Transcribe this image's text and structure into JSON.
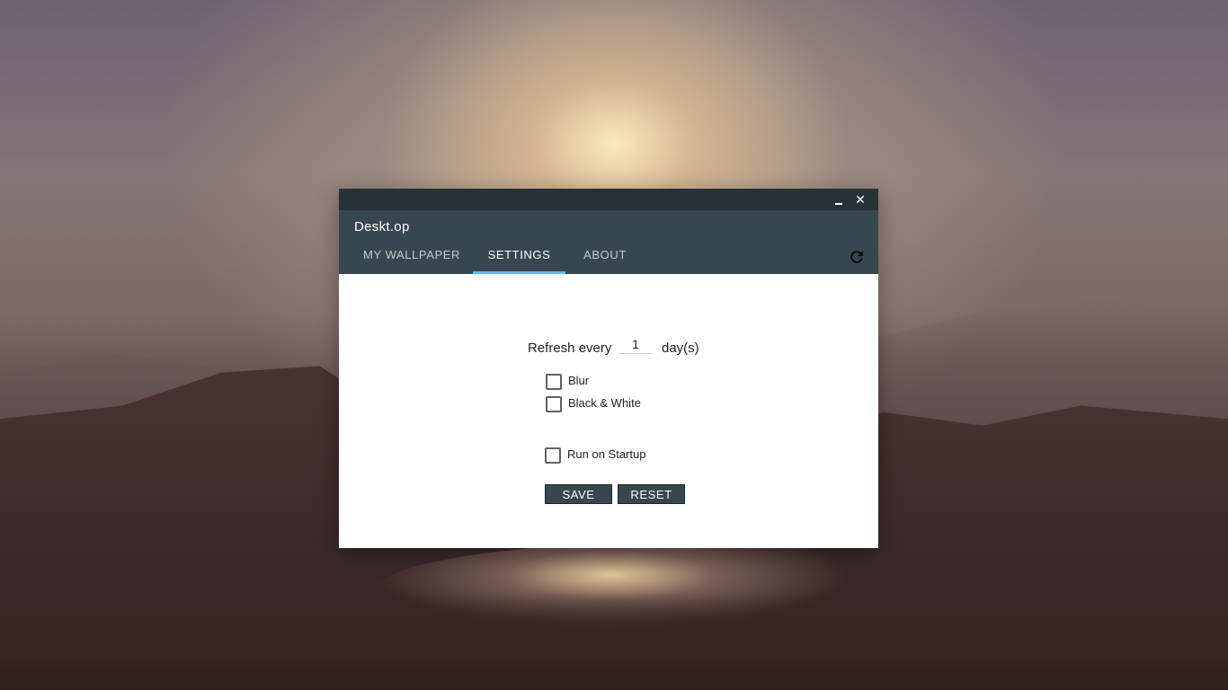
{
  "window": {
    "title": "Deskt.op",
    "close_glyph": "✕"
  },
  "tabs": [
    {
      "label": "MY WALLPAPER",
      "active": false
    },
    {
      "label": "SETTINGS",
      "active": true
    },
    {
      "label": "ABOUT",
      "active": false
    }
  ],
  "settings": {
    "refresh_label": "Refresh every",
    "refresh_value": "1",
    "refresh_unit": "day(s)",
    "options": [
      {
        "label": "Blur",
        "checked": false
      },
      {
        "label": "Black & White",
        "checked": false
      },
      {
        "label": "Run on Startup",
        "checked": false
      }
    ],
    "save_label": "SAVE",
    "reset_label": "RESET"
  },
  "icons": {
    "minimize": "minimize-icon",
    "close": "close-icon",
    "refresh": "refresh-icon"
  },
  "colors": {
    "titlebar": "#263238",
    "header": "#37474f",
    "accent": "#4fc3f7",
    "button": "#37474f"
  }
}
